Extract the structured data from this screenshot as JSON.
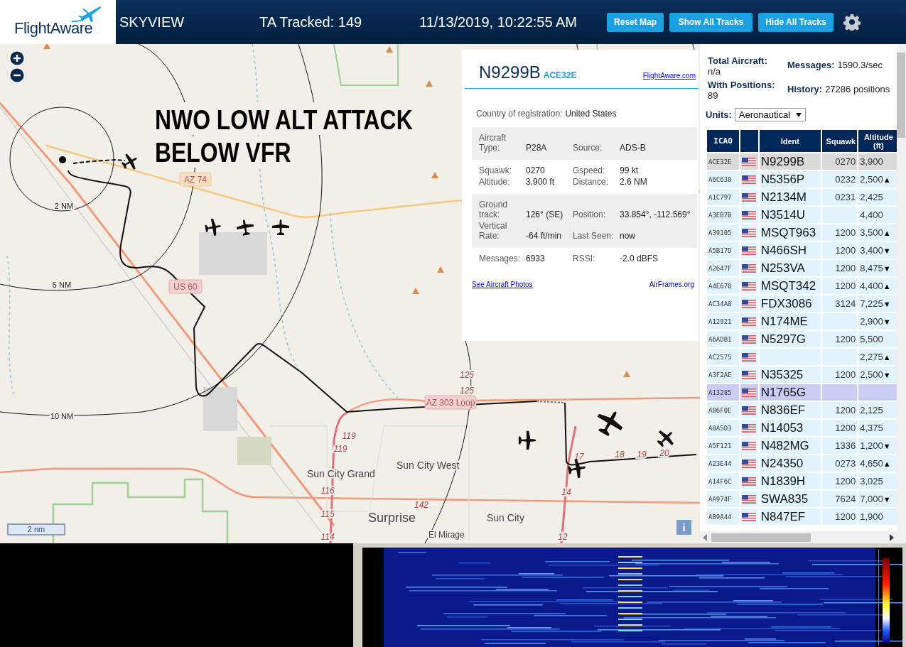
{
  "header": {
    "logo": "FlightAware",
    "title": "SKYVIEW",
    "tracked": "TA Tracked: 149",
    "datetime": "11/13/2019, 10:22:55 AM",
    "buttons": [
      "Reset Map",
      "Show All Tracks",
      "Hide All Tracks"
    ]
  },
  "map": {
    "overlay_text": [
      "NWO LOW ALT ATTACK",
      "BELOW VFR"
    ],
    "range_rings": [
      "2 NM",
      "5 NM",
      "10 NM"
    ],
    "road_shields": [
      "AZ 74",
      "US 60",
      "AZ 303 Loop"
    ],
    "places": [
      "Sun City Grand",
      "Sun City West",
      "Surprise",
      "Sun City",
      "El Mirage"
    ],
    "road_numbers": [
      "119",
      "119",
      "125",
      "125",
      "116",
      "115",
      "114",
      "142",
      "14",
      "12",
      "17",
      "18",
      "19",
      "20"
    ],
    "scale": "2 nm",
    "info_button": "i"
  },
  "popup": {
    "callsign": "N9299B",
    "hex": "ACE32E",
    "link": "FlightAware.com",
    "country_label": "Country of registration:",
    "country": "United States",
    "sections": [
      {
        "shaded": true,
        "fields": [
          {
            "label": "Aircraft Type:",
            "value": "P28A"
          },
          {
            "label": "Source:",
            "value": "ADS-B"
          }
        ]
      },
      {
        "shaded": false,
        "fields": [
          {
            "label": "Squawk:",
            "value": "0270"
          },
          {
            "label": "Gspeed:",
            "value": "99 kt"
          },
          {
            "label": "Altitude:",
            "value": "3,900 ft"
          },
          {
            "label": "Distance:",
            "value": "2.6 NM"
          }
        ]
      },
      {
        "shaded": true,
        "fields": [
          {
            "label": "Ground track:",
            "value": "126° (SE)"
          },
          {
            "label": "Position:",
            "value": "33.854°, -112.569°"
          },
          {
            "label": "Vertical Rate:",
            "value": "-64 ft/min"
          },
          {
            "label": "Last Seen:",
            "value": "now"
          }
        ]
      },
      {
        "shaded": false,
        "fields": [
          {
            "label": "Messages:",
            "value": "6933"
          },
          {
            "label": "RSSI:",
            "value": "-2.0 dBFS"
          }
        ]
      }
    ],
    "photos_link": "See Aircraft Photos",
    "airframes_link": "AirFrames.org"
  },
  "stats": [
    {
      "label": "Total Aircraft:",
      "value": "n/a"
    },
    {
      "label": "Messages:",
      "value": "1590.3/sec"
    },
    {
      "label": "With Positions:",
      "value": "89"
    },
    {
      "label": "History:",
      "value": "27286 positions"
    }
  ],
  "units": {
    "label": "Units:",
    "value": "Aeronautical"
  },
  "table": {
    "columns": [
      "ICAO",
      "Ident",
      "Squawk",
      "Altitude (ft)"
    ],
    "rows": [
      {
        "icao": "ACE32E",
        "ident": "N9299B",
        "squawk": "0270",
        "altitude": "3,900",
        "selected": true,
        "highlighted": false
      },
      {
        "icao": "A6C638",
        "ident": "N5356P",
        "squawk": "0232",
        "altitude": "2,500",
        "trend": "▲",
        "selected": false,
        "highlighted": false
      },
      {
        "icao": "A1C797",
        "ident": "N2134M",
        "squawk": "0231",
        "altitude": "2,425",
        "selected": false,
        "highlighted": false
      },
      {
        "icao": "A3EB7B",
        "ident": "N3514U",
        "altitude": "4,400",
        "selected": false,
        "highlighted": false
      },
      {
        "icao": "A39105",
        "ident": "MSQT963",
        "squawk": "1200",
        "altitude": "3,500",
        "trend": "▲",
        "selected": false,
        "highlighted": false
      },
      {
        "icao": "A5B17D",
        "ident": "N466SH",
        "squawk": "1200",
        "altitude": "3,400",
        "trend": "▼",
        "selected": false,
        "highlighted": false
      },
      {
        "icao": "A2647F",
        "ident": "N253VA",
        "squawk": "1200",
        "altitude": "8,475",
        "trend": "▼",
        "selected": false,
        "highlighted": false
      },
      {
        "icao": "A4E670",
        "ident": "MSQT342",
        "squawk": "1200",
        "altitude": "4,400",
        "trend": "▲",
        "selected": false,
        "highlighted": false
      },
      {
        "icao": "AC34A0",
        "ident": "FDX3086",
        "squawk": "3124",
        "altitude": "7,225",
        "trend": "▼",
        "selected": false,
        "highlighted": false
      },
      {
        "icao": "A12921",
        "ident": "N174ME",
        "altitude": "2,900",
        "trend": "▼",
        "selected": false,
        "highlighted": false
      },
      {
        "icao": "A6ADB1",
        "ident": "N5297G",
        "squawk": "1200",
        "altitude": "5,500",
        "selected": false,
        "highlighted": false
      },
      {
        "icao": "AC2575",
        "altitude": "2,275",
        "trend": "▲",
        "selected": false,
        "highlighted": false
      },
      {
        "icao": "A3F2AE",
        "ident": "N35325",
        "squawk": "1200",
        "altitude": "2,500",
        "trend": "▼",
        "selected": false,
        "highlighted": false
      },
      {
        "icao": "A13285",
        "ident": "N1765G",
        "selected": false,
        "highlighted": true
      },
      {
        "icao": "AB6F0E",
        "ident": "N836EF",
        "squawk": "1200",
        "altitude": "2,125",
        "selected": false,
        "highlighted": false
      },
      {
        "icao": "A0A5D3",
        "ident": "N14053",
        "squawk": "1200",
        "altitude": "4,375",
        "selected": false,
        "highlighted": false
      },
      {
        "icao": "A5F121",
        "ident": "N482MG",
        "squawk": "1336",
        "altitude": "1,200",
        "trend": "▼",
        "selected": false,
        "highlighted": false
      },
      {
        "icao": "A23E44",
        "ident": "N24350",
        "squawk": "0273",
        "altitude": "4,650",
        "trend": "▲",
        "selected": false,
        "highlighted": false
      },
      {
        "icao": "A14F6C",
        "ident": "N1839H",
        "squawk": "1200",
        "altitude": "3,025",
        "selected": false,
        "highlighted": false
      },
      {
        "icao": "AA974F",
        "ident": "SWA835",
        "squawk": "7624",
        "altitude": "7,000",
        "trend": "▼",
        "selected": false,
        "highlighted": false
      },
      {
        "icao": "AB9A44",
        "ident": "N847EF",
        "squawk": "1200",
        "altitude": "1,900",
        "selected": false,
        "highlighted": false
      }
    ]
  }
}
